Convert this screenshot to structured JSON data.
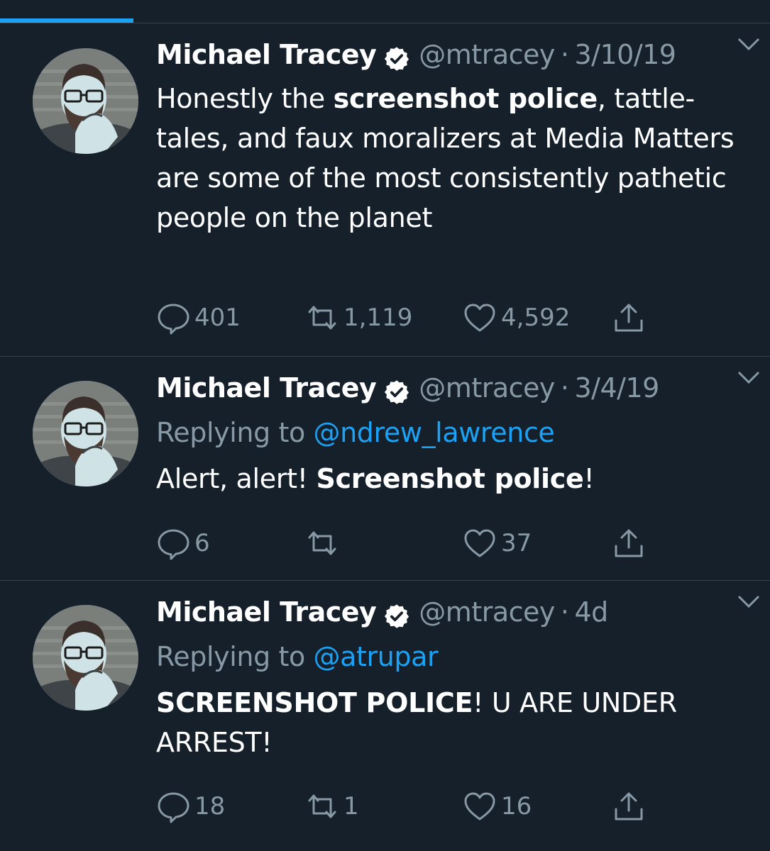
{
  "colors": {
    "background": "#15202b",
    "accent": "#1da1f2",
    "muted": "#8899a6",
    "divider": "#38444d"
  },
  "tweets": [
    {
      "name": "Michael Tracey",
      "handle": "@mtracey",
      "dot": "·",
      "time": "3/10/19",
      "reply_prefix": "",
      "reply_mention": "",
      "body": [
        {
          "text": "Honestly the ",
          "bold": false
        },
        {
          "text": "screenshot police",
          "bold": true
        },
        {
          "text": ", tattle-tales, and faux moralizers at Media Matters are some of the most consistently pathetic people on the planet",
          "bold": false
        }
      ],
      "replies": "401",
      "retweets": "1,119",
      "likes": "4,592"
    },
    {
      "name": "Michael Tracey",
      "handle": "@mtracey",
      "dot": "·",
      "time": "3/4/19",
      "reply_prefix": "Replying to ",
      "reply_mention": "@ndrew_lawrence",
      "body": [
        {
          "text": "Alert, alert! ",
          "bold": false
        },
        {
          "text": "Screenshot police",
          "bold": true
        },
        {
          "text": "!",
          "bold": false
        }
      ],
      "replies": "6",
      "retweets": "",
      "likes": "37"
    },
    {
      "name": "Michael Tracey",
      "handle": "@mtracey",
      "dot": "·",
      "time": "4d",
      "reply_prefix": "Replying to ",
      "reply_mention": "@atrupar",
      "body": [
        {
          "text": "SCREENSHOT POLICE",
          "bold": true
        },
        {
          "text": "! U ARE UNDER ARREST!",
          "bold": false
        }
      ],
      "replies": "18",
      "retweets": "1",
      "likes": "16"
    }
  ]
}
